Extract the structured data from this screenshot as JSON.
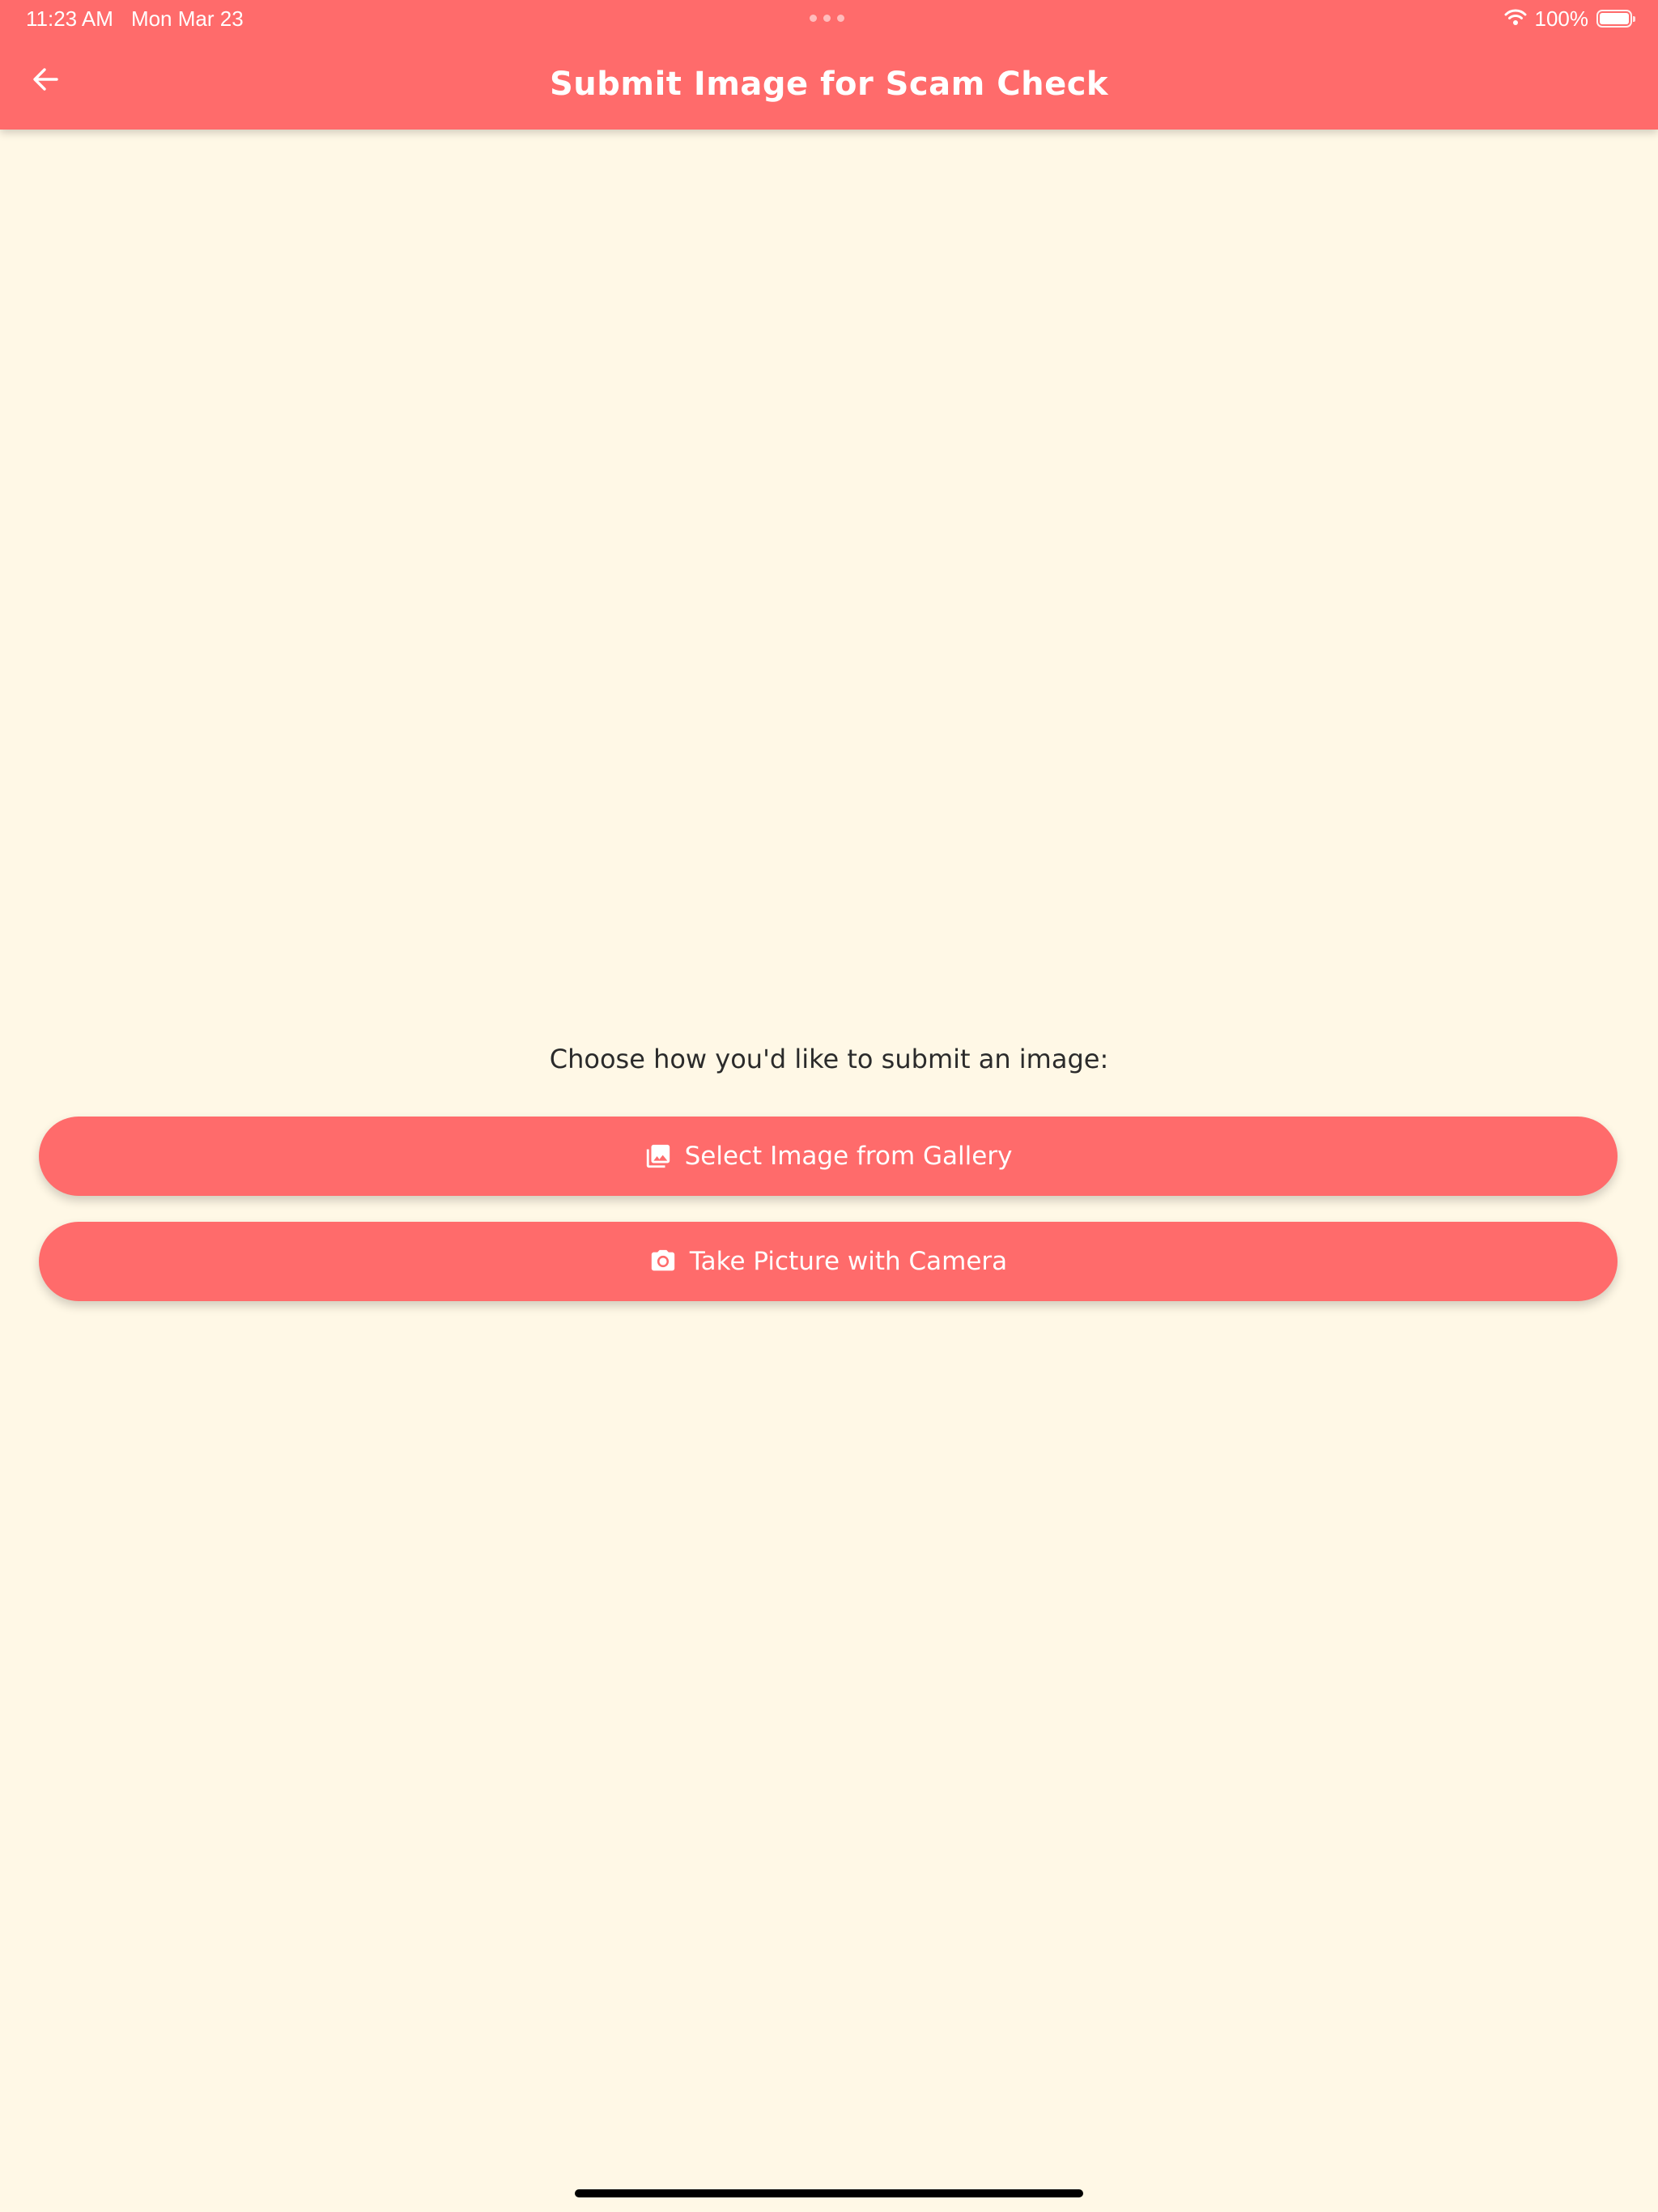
{
  "status_bar": {
    "time": "11:23 AM",
    "date": "Mon Mar 23",
    "battery_text": "100%",
    "battery_level": 1.0,
    "wifi_icon": "wifi-icon",
    "battery_icon": "battery-icon"
  },
  "header": {
    "title": "Submit Image for Scam Check",
    "back_icon": "arrow-left-icon"
  },
  "main": {
    "prompt": "Choose how you'd like to submit an image:",
    "buttons": [
      {
        "label": "Select Image from Gallery",
        "icon": "photo-library-icon"
      },
      {
        "label": "Take Picture with Camera",
        "icon": "camera-icon"
      }
    ]
  },
  "colors": {
    "accent": "#FF6B6B",
    "background": "#FFF8E6",
    "text": "#2B2B2B",
    "on_accent": "#FFFFFF"
  }
}
